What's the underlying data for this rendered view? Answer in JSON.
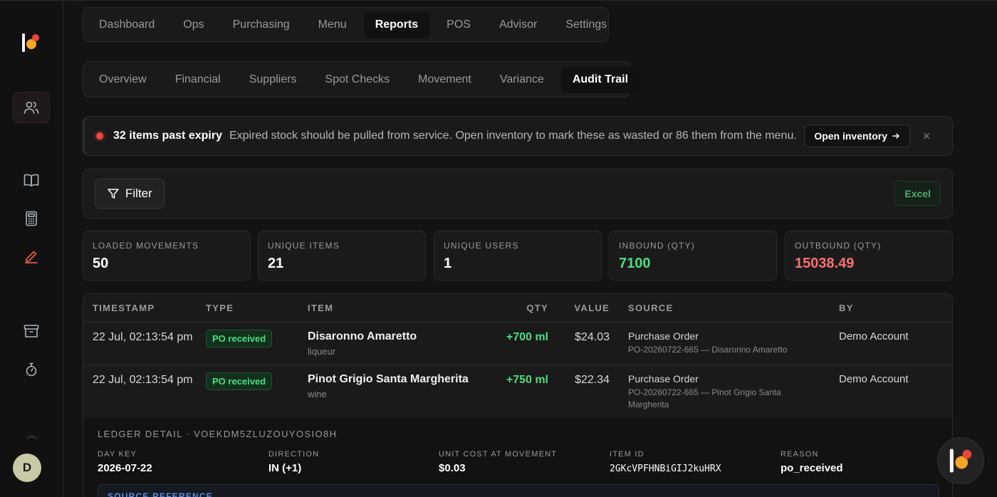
{
  "nav": {
    "top_tabs": [
      {
        "label": "Dashboard",
        "active": false
      },
      {
        "label": "Ops",
        "active": false
      },
      {
        "label": "Purchasing",
        "active": false
      },
      {
        "label": "Menu",
        "active": false
      },
      {
        "label": "Reports",
        "active": true
      },
      {
        "label": "POS",
        "active": false
      },
      {
        "label": "Advisor",
        "active": false
      },
      {
        "label": "Settings",
        "active": false
      }
    ],
    "sub_tabs": [
      {
        "label": "Overview",
        "active": false
      },
      {
        "label": "Financial",
        "active": false
      },
      {
        "label": "Suppliers",
        "active": false
      },
      {
        "label": "Spot Checks",
        "active": false
      },
      {
        "label": "Movement",
        "active": false
      },
      {
        "label": "Variance",
        "active": false
      },
      {
        "label": "Audit Trail",
        "active": true
      }
    ]
  },
  "sidebar": {
    "icons": [
      "users-icon",
      "book-icon",
      "calculator-icon",
      "pencil-icon",
      "archive-icon",
      "timer-icon"
    ],
    "avatar_initial": "D"
  },
  "alert": {
    "title": "32 items past expiry",
    "message": "Expired stock should be pulled from service. Open inventory to mark these as wasted or 86 them from the menu.",
    "button_label": "Open inventory",
    "close_glyph": "✕"
  },
  "filter": {
    "filter_label": "Filter",
    "excel_label": "Excel"
  },
  "stats": [
    {
      "label": "Loaded movements",
      "value": "50",
      "tone": "default"
    },
    {
      "label": "Unique items",
      "value": "21",
      "tone": "default"
    },
    {
      "label": "Unique users",
      "value": "1",
      "tone": "default"
    },
    {
      "label": "Inbound (qty)",
      "value": "7100",
      "tone": "green"
    },
    {
      "label": "Outbound (qty)",
      "value": "15038.49",
      "tone": "red"
    }
  ],
  "table": {
    "headers": {
      "timestamp": "Timestamp",
      "type": "Type",
      "item": "Item",
      "qty": "Qty",
      "value": "Value",
      "source": "Source",
      "by": "By"
    },
    "rows": [
      {
        "timestamp": "22 Jul, 02:13:54 pm",
        "type": "PO received",
        "item_name": "Disaronno Amaretto",
        "item_category": "liqueur",
        "qty": "+700 ml",
        "value": "$24.03",
        "source_title": "Purchase Order",
        "source_ref": "PO-20260722-665 — Disaronno Amaretto",
        "by": "Demo Account"
      },
      {
        "timestamp": "22 Jul, 02:13:54 pm",
        "type": "PO received",
        "item_name": "Pinot Grigio Santa Margherita",
        "item_category": "wine",
        "qty": "+750 ml",
        "value": "$22.34",
        "source_title": "Purchase Order",
        "source_ref": "PO-20260722-665 — Pinot Grigio Santa Margherita",
        "by": "Demo Account"
      }
    ]
  },
  "ledger": {
    "title": "Ledger detail · VOEKDM5ZLUZOUYOSIO8H",
    "fields": [
      {
        "label": "Day key",
        "value": "2026-07-22"
      },
      {
        "label": "Direction",
        "value": "IN (+1)"
      },
      {
        "label": "Unit cost at movement",
        "value": "$0.03"
      },
      {
        "label": "Item ID",
        "value": "2GKcVPFHNBiGIJ2kuHRX"
      },
      {
        "label": "Reason",
        "value": "po_received"
      }
    ],
    "source_reference_label": "Source reference"
  }
}
